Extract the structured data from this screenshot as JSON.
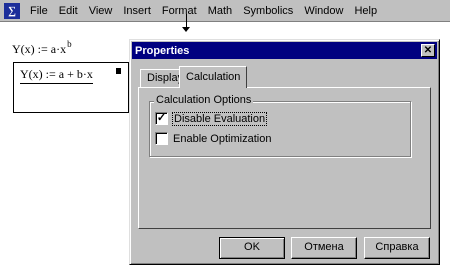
{
  "app": {
    "icon_glyph": "∑"
  },
  "menubar": {
    "items": [
      "File",
      "Edit",
      "View",
      "Insert",
      "Format",
      "Math",
      "Symbolics",
      "Window",
      "Help"
    ]
  },
  "worksheet": {
    "eq1": {
      "lhs": "Y(x)",
      "op": ":=",
      "rhs": "a·x",
      "exp": "b"
    },
    "eq2": {
      "text": "Y(x) := a + b·x"
    }
  },
  "dialog": {
    "title": "Properties",
    "close_glyph": "✕",
    "tabs": [
      "Display",
      "Calculation"
    ],
    "active_tab": "Calculation",
    "group_title": "Calculation Options",
    "options": [
      {
        "label": "Disable Evaluation",
        "checked": true
      },
      {
        "label": "Enable Optimization",
        "checked": false
      }
    ],
    "buttons": {
      "ok": "OK",
      "cancel": "Отмена",
      "help": "Справка"
    }
  }
}
